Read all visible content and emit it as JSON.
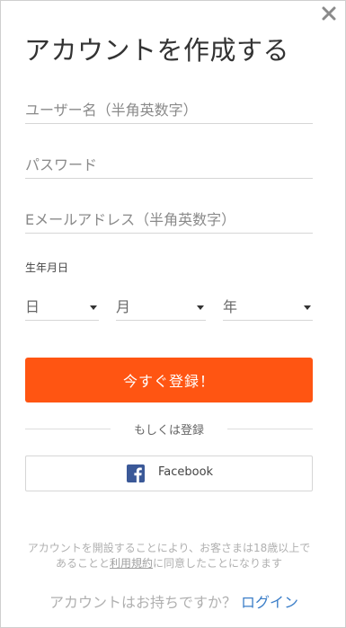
{
  "modal": {
    "title": "アカウントを作成する",
    "close_icon": "close-icon"
  },
  "form": {
    "username_placeholder": "ユーザー名（半角英数字）",
    "password_placeholder": "パスワード",
    "email_placeholder": "Eメールアドレス（半角英数字）",
    "dob_label": "生年月日",
    "day_selected": "日",
    "month_selected": "月",
    "year_selected": "年",
    "submit_label": "今すぐ登録！"
  },
  "social": {
    "divider_text": "もしくは登録",
    "facebook_label": "Facebook",
    "facebook_icon": "facebook-icon",
    "facebook_color": "#3b5998"
  },
  "terms": {
    "text_before": "アカウントを開設することにより、お客さまは18歳以上であることと",
    "link": "利用規約",
    "text_after": "に同意したことになります"
  },
  "login": {
    "prompt": "アカウントはお持ちですか？ ",
    "link": "ログイン"
  },
  "colors": {
    "primary": "#ff5512",
    "link": "#3b7ec8"
  }
}
